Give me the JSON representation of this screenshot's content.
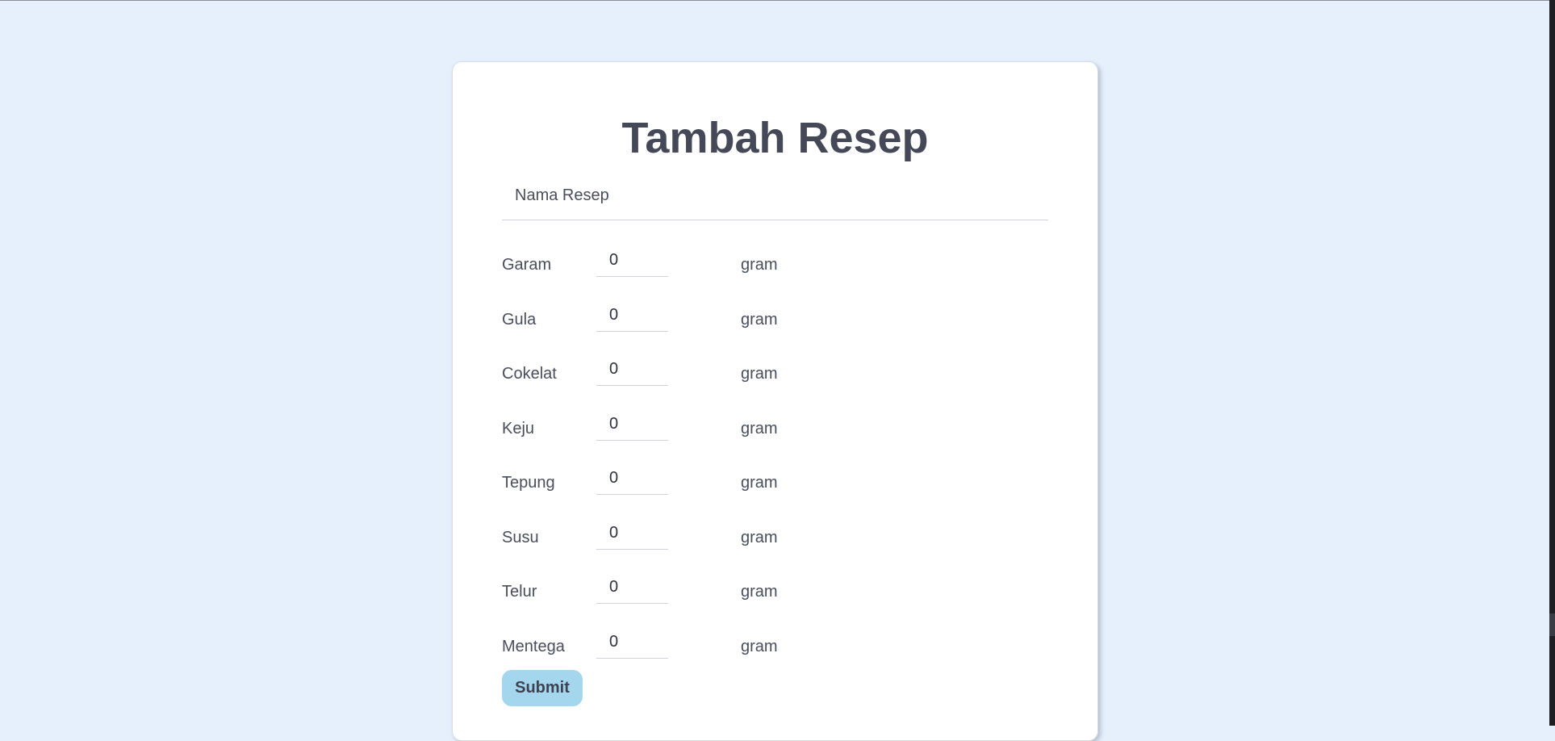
{
  "form": {
    "title": "Tambah Resep",
    "recipe_name": {
      "placeholder": "Nama Resep",
      "value": ""
    },
    "unit_label": "gram",
    "ingredients": [
      {
        "label": "Garam",
        "value": "0"
      },
      {
        "label": "Gula",
        "value": "0"
      },
      {
        "label": "Cokelat",
        "value": "0"
      },
      {
        "label": "Keju",
        "value": "0"
      },
      {
        "label": "Tepung",
        "value": "0"
      },
      {
        "label": "Susu",
        "value": "0"
      },
      {
        "label": "Telur",
        "value": "0"
      },
      {
        "label": "Mentega",
        "value": "0"
      }
    ],
    "submit_label": "Submit"
  },
  "colors": {
    "page_background": "#e6f0fd",
    "card_background": "#ffffff",
    "button_background": "#a4d6ee",
    "text": "#4a4d5c"
  }
}
